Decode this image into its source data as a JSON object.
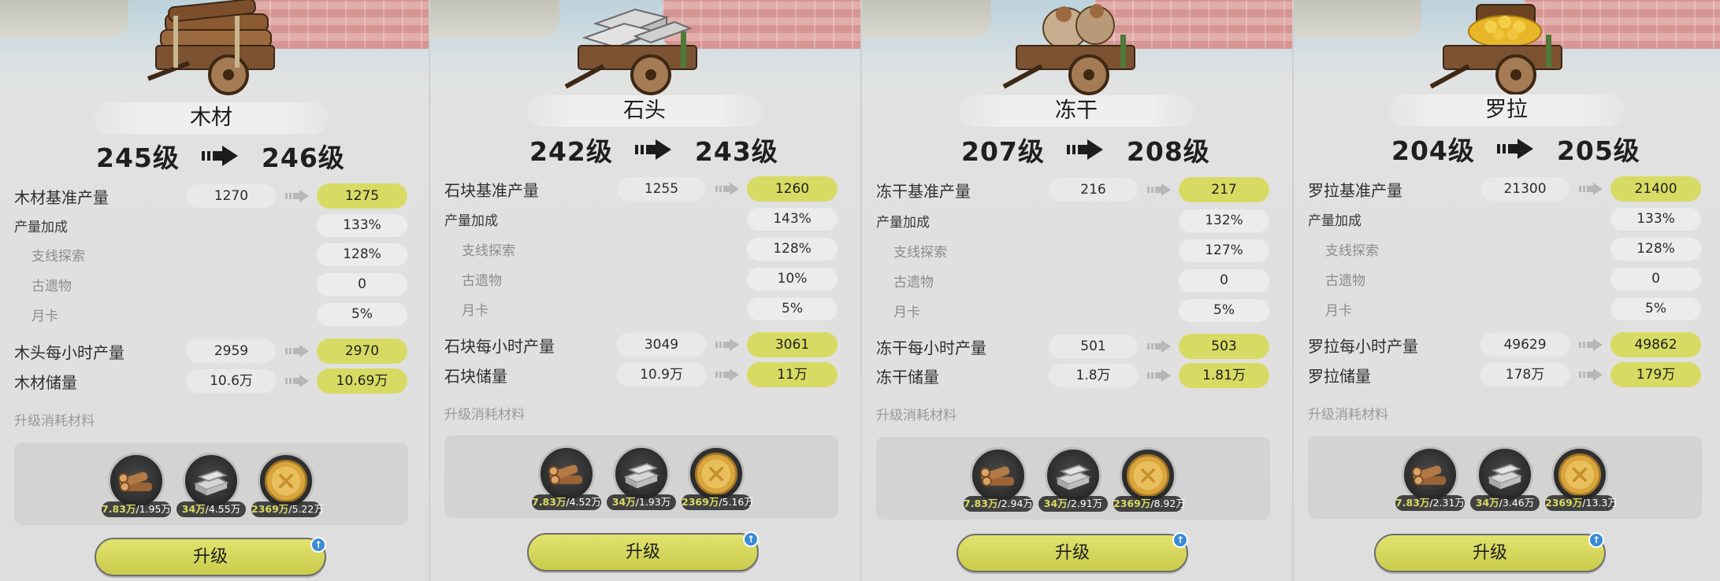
{
  "colors": {
    "highlight": "#d8db63",
    "button": "#d6d85b",
    "badge": "#3a8ad6"
  },
  "panels": [
    {
      "name": "木材",
      "level_from": "245级",
      "level_to": "246级",
      "base_label": "木材基准产量",
      "base_cur": "1270",
      "base_next": "1275",
      "bonus_label": "产量加成",
      "bonus_val": "133%",
      "branch_label": "支线探索",
      "branch_val": "128%",
      "relic_label": "古遗物",
      "relic_val": "0",
      "card_label": "月卡",
      "card_val": "5%",
      "hourly_label": "木头每小时产量",
      "hourly_cur": "2959",
      "hourly_next": "2970",
      "storage_label": "木材储量",
      "storage_cur": "10.6万",
      "storage_next": "10.69万",
      "materials_title": "升级消耗材料",
      "materials": [
        {
          "icon": "wood-icon",
          "have": "7.83万",
          "need": "/1.95万"
        },
        {
          "icon": "stone-icon",
          "have": "34万",
          "need": "/4.55万"
        },
        {
          "icon": "coin-icon",
          "have": "2369万",
          "need": "/5.22万"
        }
      ],
      "button": "升级",
      "badge": "↑"
    },
    {
      "name": "石头",
      "level_from": "242级",
      "level_to": "243级",
      "base_label": "石块基准产量",
      "base_cur": "1255",
      "base_next": "1260",
      "bonus_label": "产量加成",
      "bonus_val": "143%",
      "branch_label": "支线探索",
      "branch_val": "128%",
      "relic_label": "古遗物",
      "relic_val": "10%",
      "card_label": "月卡",
      "card_val": "5%",
      "hourly_label": "石块每小时产量",
      "hourly_cur": "3049",
      "hourly_next": "3061",
      "storage_label": "石块储量",
      "storage_cur": "10.9万",
      "storage_next": "11万",
      "materials_title": "升级消耗材料",
      "materials": [
        {
          "icon": "wood-icon",
          "have": "7.83万",
          "need": "/4.52万"
        },
        {
          "icon": "stone-icon",
          "have": "34万",
          "need": "/1.93万"
        },
        {
          "icon": "coin-icon",
          "have": "2369万",
          "need": "/5.16万"
        }
      ],
      "button": "升级",
      "badge": "↑"
    },
    {
      "name": "冻干",
      "level_from": "207级",
      "level_to": "208级",
      "base_label": "冻干基准产量",
      "base_cur": "216",
      "base_next": "217",
      "bonus_label": "产量加成",
      "bonus_val": "132%",
      "branch_label": "支线探索",
      "branch_val": "127%",
      "relic_label": "古遗物",
      "relic_val": "0",
      "card_label": "月卡",
      "card_val": "5%",
      "hourly_label": "冻干每小时产量",
      "hourly_cur": "501",
      "hourly_next": "503",
      "storage_label": "冻干储量",
      "storage_cur": "1.8万",
      "storage_next": "1.81万",
      "materials_title": "升级消耗材料",
      "materials": [
        {
          "icon": "wood-icon",
          "have": "7.83万",
          "need": "/2.94万"
        },
        {
          "icon": "stone-icon",
          "have": "34万",
          "need": "/2.91万"
        },
        {
          "icon": "coin-icon",
          "have": "2369万",
          "need": "/8.92万"
        }
      ],
      "button": "升级",
      "badge": "↑"
    },
    {
      "name": "罗拉",
      "level_from": "204级",
      "level_to": "205级",
      "base_label": "罗拉基准产量",
      "base_cur": "21300",
      "base_next": "21400",
      "bonus_label": "产量加成",
      "bonus_val": "133%",
      "branch_label": "支线探索",
      "branch_val": "128%",
      "relic_label": "古遗物",
      "relic_val": "0",
      "card_label": "月卡",
      "card_val": "5%",
      "hourly_label": "罗拉每小时产量",
      "hourly_cur": "49629",
      "hourly_next": "49862",
      "storage_label": "罗拉储量",
      "storage_cur": "178万",
      "storage_next": "179万",
      "materials_title": "升级消耗材料",
      "materials": [
        {
          "icon": "wood-icon",
          "have": "7.83万",
          "need": "/2.31万"
        },
        {
          "icon": "stone-icon",
          "have": "34万",
          "need": "/3.46万"
        },
        {
          "icon": "coin-icon",
          "have": "2369万",
          "need": "/13.3万"
        }
      ],
      "button": "升级",
      "badge": "↑"
    }
  ]
}
